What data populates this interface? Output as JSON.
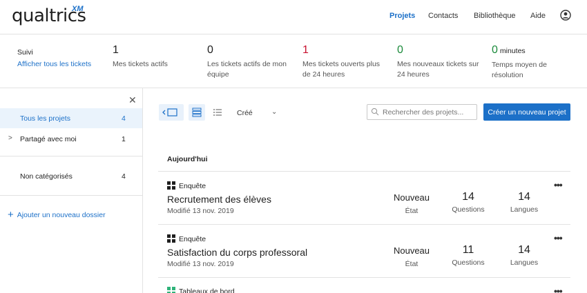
{
  "header": {
    "logo": "qualtrics",
    "logo_suffix": "XM",
    "nav": [
      {
        "label": "Projets",
        "active": true
      },
      {
        "label": "Contacts",
        "active": false
      },
      {
        "label": "Bibliothèque",
        "active": false
      },
      {
        "label": "Aide",
        "active": false
      }
    ],
    "user_icon": "user-circle-icon"
  },
  "stats": {
    "suivi_label": "Suivi",
    "suivi_link": "Afficher tous les tickets",
    "items": [
      {
        "value": "1",
        "unit": "",
        "text": "Mes tickets actifs",
        "color": "#1f1f1f"
      },
      {
        "value": "0",
        "unit": "",
        "text": "Les tickets actifs de mon équipe",
        "color": "#1f1f1f"
      },
      {
        "value": "1",
        "unit": "",
        "text": "Mes tickets ouverts plus de 24 heures",
        "color": "#c8102e"
      },
      {
        "value": "0",
        "unit": "",
        "text": "Mes nouveaux tickets sur 24 heures",
        "color": "#1a8a3a"
      },
      {
        "value": "0",
        "unit": "minutes",
        "text": "Temps moyen de résolution",
        "color": "#1a8a3a"
      }
    ]
  },
  "sidebar": {
    "close_icon": "close-icon",
    "items": [
      {
        "label": "Tous les projets",
        "count": "4",
        "active": true
      },
      {
        "label": "Partagé avec moi",
        "count": "1",
        "active": false
      },
      {
        "label": "Non catégorisés",
        "count": "4",
        "active": false
      }
    ],
    "add_folder": "Ajouter un nouveau dossier"
  },
  "toolbar": {
    "sort_label": "Créé",
    "search_placeholder": "Rechercher des projets...",
    "create_label": "Créer un nouveau projet"
  },
  "section": {
    "title": "Aujourd'hui"
  },
  "projects": [
    {
      "type": "Enquête",
      "name": "Recrutement des élèves",
      "modified": "Modifié 13 nov. 2019",
      "state": "Nouveau",
      "state_label": "État",
      "questions": "14",
      "questions_label": "Questions",
      "languages": "14",
      "languages_label": "Langues"
    },
    {
      "type": "Enquête",
      "name": "Satisfaction du corps professoral",
      "modified": "Modifié 13 nov. 2019",
      "state": "Nouveau",
      "state_label": "État",
      "questions": "11",
      "questions_label": "Questions",
      "languages": "14",
      "languages_label": "Langues"
    },
    {
      "type": "Tableaux de bord"
    }
  ],
  "colors": {
    "accent": "#1c70c8",
    "survey_icon": "#1f1f1f",
    "dashboard_icon": "#2fb37a"
  }
}
